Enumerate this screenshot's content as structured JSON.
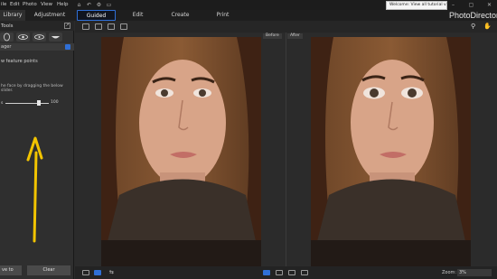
{
  "menu": {
    "items": [
      "ile",
      "Edit",
      "Photo",
      "View",
      "Help"
    ]
  },
  "tabs": {
    "left": [
      "Library",
      "Adjustment"
    ],
    "main": [
      "Guided",
      "Edit",
      "Create",
      "Print"
    ]
  },
  "tooltip": "Welcome: View all tutorial videos here!",
  "brand": "PhotoDirector",
  "panel": {
    "title": "Tools",
    "section": "ager",
    "show_points": "w feature points",
    "hint": "he face by dragging the below slider.",
    "slider_label": "s",
    "slider_value": "100",
    "slider_level": 0.72,
    "apply_label": "ve to",
    "clear_label": "Clear"
  },
  "compare": {
    "before": "Before",
    "after": "After"
  },
  "zoom": {
    "label": "Zoom:",
    "value": "3%"
  },
  "colors": {
    "accent": "#2f6fd6",
    "arrow": "#f2c400"
  }
}
